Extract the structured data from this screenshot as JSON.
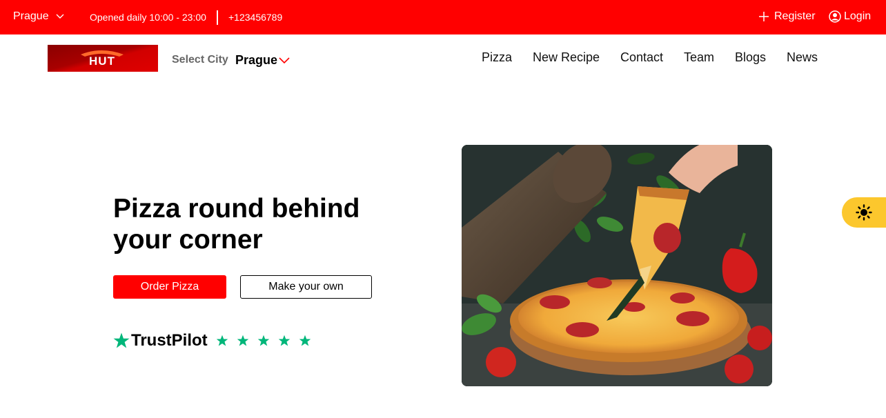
{
  "topbar": {
    "city": "Prague",
    "hours": "Opened daily 10:00 - 23:00",
    "phone": "+123456789",
    "register_label": "Register",
    "login_label": "Login"
  },
  "header": {
    "logo_text": "HUT",
    "select_city_label": "Select City",
    "selected_city": "Prague",
    "nav": [
      "Pizza",
      "New Recipe",
      "Contact",
      "Team",
      "Blogs",
      "News"
    ]
  },
  "hero": {
    "title": "Pizza round behind your corner",
    "order_button": "Order Pizza",
    "make_button": "Make your own",
    "trustpilot_name": "TrustPilot",
    "rating": 5
  },
  "colors": {
    "brand_red": "#ff0000",
    "trust_green": "#00b67a",
    "toggle_yellow": "#fcc72d"
  },
  "icons": [
    "chevron-down-icon",
    "plus-icon",
    "user-circle-icon",
    "star-icon",
    "sun-icon"
  ]
}
